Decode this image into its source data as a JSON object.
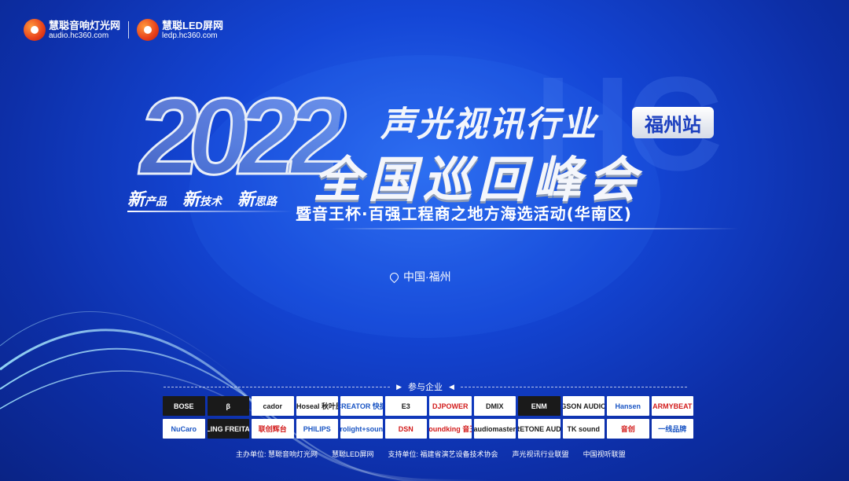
{
  "logos": [
    {
      "name": "慧聪音响灯光网",
      "url": "audio.hc360.com"
    },
    {
      "name": "慧聪LED屏网",
      "url": "ledp.hc360.com"
    }
  ],
  "watermark": "HC",
  "year": "2022",
  "title_line1": "声光视讯行业",
  "station": "福州站",
  "title_line2": "全国巡回峰会",
  "tags": [
    {
      "prefix": "新",
      "text": "产品"
    },
    {
      "prefix": "新",
      "text": "技术"
    },
    {
      "prefix": "新",
      "text": "思路"
    }
  ],
  "subtitle": "暨音王杯·百强工程商之地方海选活动(华南区)",
  "location": "中国·福州",
  "participants_label": "参与企业",
  "sponsors": [
    "BOSE",
    "β",
    "cador",
    "CHoseal 秋叶原",
    "CREATOR 快捷",
    "E3",
    "DJPOWER",
    "DMIX",
    "ENM",
    "GSON AUDIO",
    "Hansen",
    "ARMYBEAT",
    "NuCaro",
    "KLING FREITAG",
    "联创辉台",
    "PHILIPS",
    "prolight+sound",
    "DSN",
    "Soundking 音王",
    "audiomaster",
    "CRETONE AUDIO",
    "TK sound",
    "音创",
    "一线品牌"
  ],
  "footer": [
    "主办单位: 慧聪音响灯光网",
    "慧聪LED屏网",
    "支持单位: 福建省演艺设备技术协会",
    "声光视讯行业联盟",
    "中国视听联盟"
  ],
  "colors": {
    "background": "#1446d6",
    "accent": "#ffffff"
  }
}
